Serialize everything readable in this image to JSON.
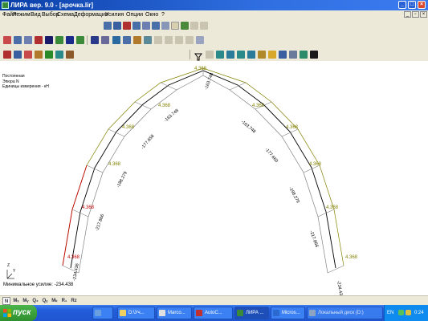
{
  "window": {
    "title": "ЛИРА  вер. 9.0 - [арочка.lir]",
    "buttons": {
      "minimize": "_",
      "maximize": "□",
      "close": "×"
    }
  },
  "menubar": {
    "items": [
      "Файл",
      "Режим",
      "Вид",
      "Выбор",
      "Схема",
      "Деформации",
      "Усилия",
      "Опции",
      "Окно",
      "?"
    ],
    "mdi_minimize": "_",
    "mdi_restore": "▫",
    "mdi_close": "×"
  },
  "canvas": {
    "info_lines": [
      "Постоянная",
      "Эпюра  N",
      "Единицы измерения - кН"
    ],
    "min_note": "Минимальное усилие: -234.438",
    "axis_z": "Z",
    "axis_y": "Y",
    "load_labels": [
      "4.368",
      "4.368",
      "4.368",
      "4.368",
      "4.368",
      "4.368",
      "4.368",
      "4.368",
      "4.368",
      "4.368",
      "4.368"
    ],
    "force_labels": [
      "-234.436",
      "-217.866",
      "-198.279",
      "-177.658",
      "-163.748",
      "-163.748",
      "-163.748",
      "-177.660",
      "-198.279",
      "-217.866",
      "-234.436"
    ]
  },
  "bottombar": {
    "items": [
      "N",
      "Mₓ",
      "Mᵧ",
      "Q₂",
      "Qᵧ",
      "Mₖ",
      "R₁",
      "Rz"
    ]
  },
  "taskbar": {
    "start_label": "пуск",
    "tasks": [
      "",
      "D:\\Уч...",
      "Marco...",
      "AutoC...",
      "ЛИРА ...",
      "Micros...",
      "Локальный диск (D:)"
    ],
    "lang": "EN",
    "clock": "0:24"
  },
  "colors": {
    "arch": "#808080",
    "member": "#000000",
    "load": "#808000",
    "load_emph": "#c00000",
    "titlebar": "#2f6ee0"
  }
}
